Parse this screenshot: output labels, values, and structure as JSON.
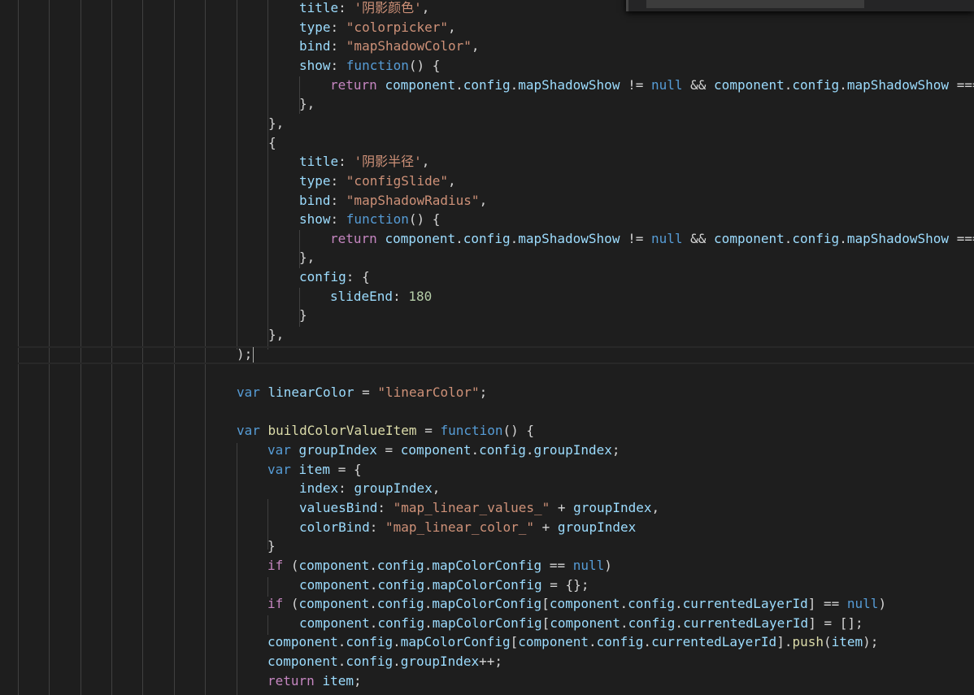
{
  "find_widget": {
    "query": "",
    "result": ""
  },
  "code_lines": [
    [
      [
        "prop",
        "title"
      ],
      [
        "punc",
        ": "
      ],
      [
        "str",
        "'阴影颜色'"
      ],
      [
        "punc",
        ","
      ]
    ],
    [
      [
        "prop",
        "type"
      ],
      [
        "punc",
        ": "
      ],
      [
        "str",
        "\"colorpicker\""
      ],
      [
        "punc",
        ","
      ]
    ],
    [
      [
        "prop",
        "bind"
      ],
      [
        "punc",
        ": "
      ],
      [
        "str",
        "\"mapShadowColor\""
      ],
      [
        "punc",
        ","
      ]
    ],
    [
      [
        "prop",
        "show"
      ],
      [
        "punc",
        ": "
      ],
      [
        "kw",
        "function"
      ],
      [
        "punc",
        "() {"
      ]
    ],
    [
      [
        "ctrl",
        "return "
      ],
      [
        "prop",
        "component"
      ],
      [
        "punc",
        "."
      ],
      [
        "prop",
        "config"
      ],
      [
        "punc",
        "."
      ],
      [
        "prop",
        "mapShadowShow"
      ],
      [
        "op",
        " != "
      ],
      [
        "kw",
        "null"
      ],
      [
        "op",
        " && "
      ],
      [
        "prop",
        "component"
      ],
      [
        "punc",
        "."
      ],
      [
        "prop",
        "config"
      ],
      [
        "punc",
        "."
      ],
      [
        "prop",
        "mapShadowShow"
      ],
      [
        "op",
        " ==="
      ]
    ],
    [
      [
        "punc",
        "},"
      ]
    ],
    [
      [
        "punc",
        "},"
      ]
    ],
    [
      [
        "punc",
        "{"
      ]
    ],
    [
      [
        "prop",
        "title"
      ],
      [
        "punc",
        ": "
      ],
      [
        "str",
        "'阴影半径'"
      ],
      [
        "punc",
        ","
      ]
    ],
    [
      [
        "prop",
        "type"
      ],
      [
        "punc",
        ": "
      ],
      [
        "str",
        "\"configSlide\""
      ],
      [
        "punc",
        ","
      ]
    ],
    [
      [
        "prop",
        "bind"
      ],
      [
        "punc",
        ": "
      ],
      [
        "str",
        "\"mapShadowRadius\""
      ],
      [
        "punc",
        ","
      ]
    ],
    [
      [
        "prop",
        "show"
      ],
      [
        "punc",
        ": "
      ],
      [
        "kw",
        "function"
      ],
      [
        "punc",
        "() {"
      ]
    ],
    [
      [
        "ctrl",
        "return "
      ],
      [
        "prop",
        "component"
      ],
      [
        "punc",
        "."
      ],
      [
        "prop",
        "config"
      ],
      [
        "punc",
        "."
      ],
      [
        "prop",
        "mapShadowShow"
      ],
      [
        "op",
        " != "
      ],
      [
        "kw",
        "null"
      ],
      [
        "op",
        " && "
      ],
      [
        "prop",
        "component"
      ],
      [
        "punc",
        "."
      ],
      [
        "prop",
        "config"
      ],
      [
        "punc",
        "."
      ],
      [
        "prop",
        "mapShadowShow"
      ],
      [
        "op",
        " ==="
      ]
    ],
    [
      [
        "punc",
        "},"
      ]
    ],
    [
      [
        "prop",
        "config"
      ],
      [
        "punc",
        ": {"
      ]
    ],
    [
      [
        "prop",
        "slideEnd"
      ],
      [
        "punc",
        ": "
      ],
      [
        "num",
        "180"
      ]
    ],
    [
      [
        "punc",
        "}"
      ]
    ],
    [
      [
        "punc",
        "},"
      ]
    ],
    [
      [
        "punc",
        ");"
      ]
    ],
    [],
    [
      [
        "kw",
        "var "
      ],
      [
        "prop",
        "linearColor"
      ],
      [
        "op",
        " = "
      ],
      [
        "str",
        "\"linearColor\""
      ],
      [
        "punc",
        ";"
      ]
    ],
    [],
    [
      [
        "kw",
        "var "
      ],
      [
        "fn",
        "buildColorValueItem"
      ],
      [
        "op",
        " = "
      ],
      [
        "kw",
        "function"
      ],
      [
        "punc",
        "() {"
      ]
    ],
    [
      [
        "kw",
        "var "
      ],
      [
        "prop",
        "groupIndex"
      ],
      [
        "op",
        " = "
      ],
      [
        "prop",
        "component"
      ],
      [
        "punc",
        "."
      ],
      [
        "prop",
        "config"
      ],
      [
        "punc",
        "."
      ],
      [
        "prop",
        "groupIndex"
      ],
      [
        "punc",
        ";"
      ]
    ],
    [
      [
        "kw",
        "var "
      ],
      [
        "prop",
        "item"
      ],
      [
        "op",
        " = "
      ],
      [
        "punc",
        "{"
      ]
    ],
    [
      [
        "prop",
        "index"
      ],
      [
        "punc",
        ": "
      ],
      [
        "prop",
        "groupIndex"
      ],
      [
        "punc",
        ","
      ]
    ],
    [
      [
        "prop",
        "valuesBind"
      ],
      [
        "punc",
        ": "
      ],
      [
        "str",
        "\"map_linear_values_\""
      ],
      [
        "op",
        " + "
      ],
      [
        "prop",
        "groupIndex"
      ],
      [
        "punc",
        ","
      ]
    ],
    [
      [
        "prop",
        "colorBind"
      ],
      [
        "punc",
        ": "
      ],
      [
        "str",
        "\"map_linear_color_\""
      ],
      [
        "op",
        " + "
      ],
      [
        "prop",
        "groupIndex"
      ]
    ],
    [
      [
        "punc",
        "}"
      ]
    ],
    [
      [
        "ctrl",
        "if "
      ],
      [
        "punc",
        "("
      ],
      [
        "prop",
        "component"
      ],
      [
        "punc",
        "."
      ],
      [
        "prop",
        "config"
      ],
      [
        "punc",
        "."
      ],
      [
        "prop",
        "mapColorConfig"
      ],
      [
        "op",
        " == "
      ],
      [
        "kw",
        "null"
      ],
      [
        "punc",
        ")"
      ]
    ],
    [
      [
        "prop",
        "component"
      ],
      [
        "punc",
        "."
      ],
      [
        "prop",
        "config"
      ],
      [
        "punc",
        "."
      ],
      [
        "prop",
        "mapColorConfig"
      ],
      [
        "op",
        " = "
      ],
      [
        "punc",
        "{};"
      ]
    ],
    [
      [
        "ctrl",
        "if "
      ],
      [
        "punc",
        "("
      ],
      [
        "prop",
        "component"
      ],
      [
        "punc",
        "."
      ],
      [
        "prop",
        "config"
      ],
      [
        "punc",
        "."
      ],
      [
        "prop",
        "mapColorConfig"
      ],
      [
        "punc",
        "["
      ],
      [
        "prop",
        "component"
      ],
      [
        "punc",
        "."
      ],
      [
        "prop",
        "config"
      ],
      [
        "punc",
        "."
      ],
      [
        "prop",
        "currentedLayerId"
      ],
      [
        "punc",
        "]"
      ],
      [
        "op",
        " == "
      ],
      [
        "kw",
        "null"
      ],
      [
        "punc",
        ")"
      ]
    ],
    [
      [
        "prop",
        "component"
      ],
      [
        "punc",
        "."
      ],
      [
        "prop",
        "config"
      ],
      [
        "punc",
        "."
      ],
      [
        "prop",
        "mapColorConfig"
      ],
      [
        "punc",
        "["
      ],
      [
        "prop",
        "component"
      ],
      [
        "punc",
        "."
      ],
      [
        "prop",
        "config"
      ],
      [
        "punc",
        "."
      ],
      [
        "prop",
        "currentedLayerId"
      ],
      [
        "punc",
        "]"
      ],
      [
        "op",
        " = "
      ],
      [
        "punc",
        "[];"
      ]
    ],
    [
      [
        "prop",
        "component"
      ],
      [
        "punc",
        "."
      ],
      [
        "prop",
        "config"
      ],
      [
        "punc",
        "."
      ],
      [
        "prop",
        "mapColorConfig"
      ],
      [
        "punc",
        "["
      ],
      [
        "prop",
        "component"
      ],
      [
        "punc",
        "."
      ],
      [
        "prop",
        "config"
      ],
      [
        "punc",
        "."
      ],
      [
        "prop",
        "currentedLayerId"
      ],
      [
        "punc",
        "]."
      ],
      [
        "fn",
        "push"
      ],
      [
        "punc",
        "("
      ],
      [
        "prop",
        "item"
      ],
      [
        "punc",
        ");"
      ]
    ],
    [
      [
        "prop",
        "component"
      ],
      [
        "punc",
        "."
      ],
      [
        "prop",
        "config"
      ],
      [
        "punc",
        "."
      ],
      [
        "prop",
        "groupIndex"
      ],
      [
        "op",
        "++"
      ],
      [
        "punc",
        ";"
      ]
    ],
    [
      [
        "ctrl",
        "return "
      ],
      [
        "prop",
        "item"
      ],
      [
        "punc",
        ";"
      ]
    ]
  ]
}
